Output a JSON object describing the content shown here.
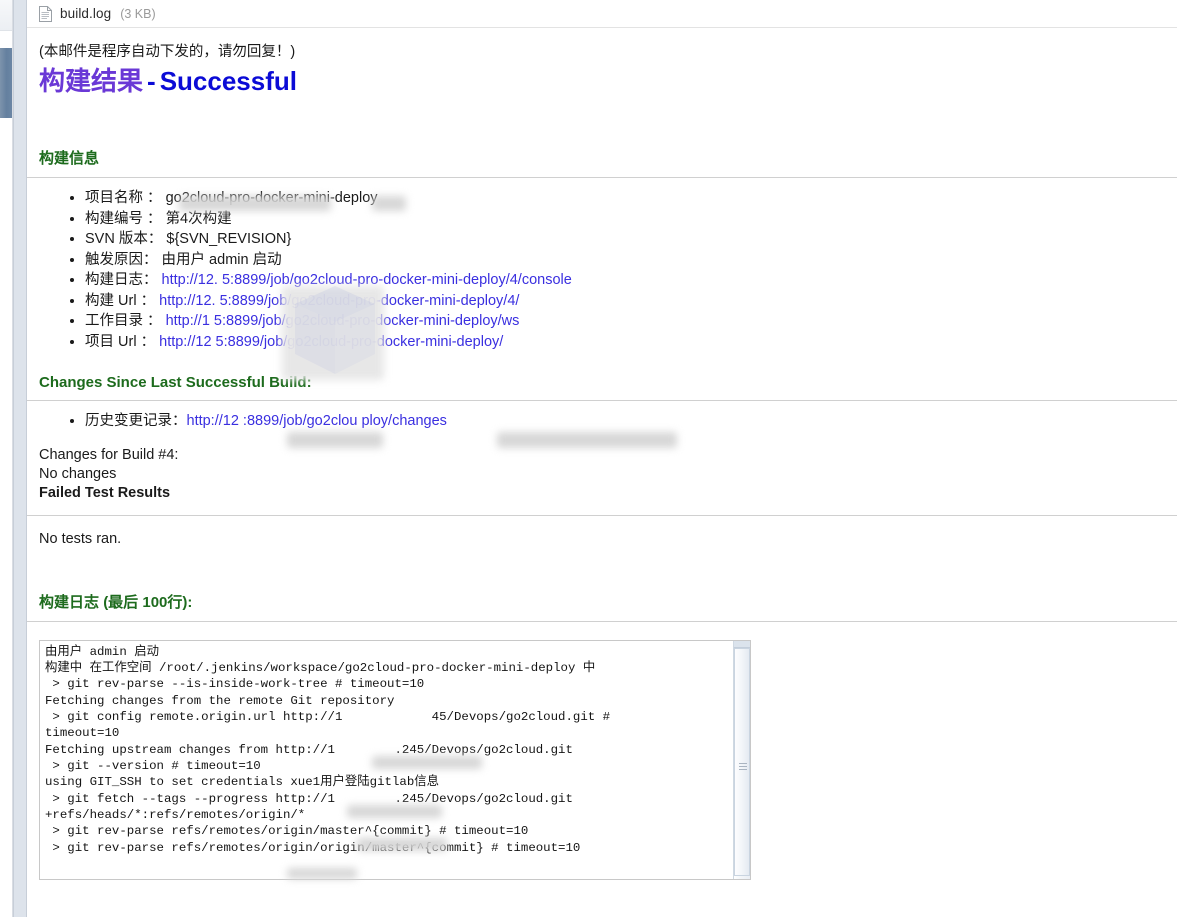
{
  "attachment": {
    "icon": "document-icon",
    "filename": "build.log",
    "size": "(3 KB)"
  },
  "mail": {
    "auto_note": "(本邮件是程序自动下发的，请勿回复！)",
    "title_cn": "构建结果",
    "title_dash": "-",
    "title_status": "Successful",
    "status_color": "#0b0bd6",
    "title_color": "#6a38d6"
  },
  "build_info": {
    "heading": "构建信息",
    "items": [
      {
        "label": "项目名称 ：",
        "value": "go2cloud-pro-docker-mini-deploy",
        "is_link": false
      },
      {
        "label": "构建编号 ：",
        "value": "第4次构建",
        "is_link": false
      },
      {
        "label": "SVN 版本：",
        "value": "${SVN_REVISION}",
        "is_link": false
      },
      {
        "label": "触发原因：",
        "value": "由用户 admin 启动",
        "is_link": false
      },
      {
        "label": "构建日志：",
        "value": "http://12.     5:8899/job/go2cloud-pro-docker-mini-deploy/4/console",
        "is_link": true
      },
      {
        "label": "构建 Url ：",
        "value": "http://12.     5:8899/job/go2cloud-pro-docker-mini-deploy/4/",
        "is_link": true
      },
      {
        "label": "工作目录 ：",
        "value": "http://1      5:8899/job/go2cloud-pro-docker-mini-deploy/ws",
        "is_link": true
      },
      {
        "label": "项目 Url ：",
        "value": "http://12     5:8899/job/go2cloud-pro-docker-mini-deploy/",
        "is_link": true
      }
    ]
  },
  "changes": {
    "heading": "Changes Since Last Successful Build:",
    "items": [
      {
        "label": "历史变更记录：",
        "value": "http://12      :8899/job/go2clou                ploy/changes",
        "is_link": true
      }
    ],
    "build_line": "Changes for Build #4:",
    "no_changes": "No changes",
    "failed_tests_heading": "Failed Test Results",
    "no_tests": "No tests ran."
  },
  "console": {
    "heading_cn": "构建日志",
    "heading_suffix": "(最后 100行):",
    "lines": [
      "由用户 admin 启动",
      "构建中 在工作空间 /root/.jenkins/workspace/go2cloud-pro-docker-mini-deploy 中",
      " > git rev-parse --is-inside-work-tree # timeout=10",
      "Fetching changes from the remote Git repository",
      " > git config remote.origin.url http://1            45/Devops/go2cloud.git #",
      "timeout=10",
      "Fetching upstream changes from http://1        .245/Devops/go2cloud.git",
      " > git --version # timeout=10",
      "using GIT_SSH to set credentials xue1用户登陆gitlab信息",
      " > git fetch --tags --progress http://1        .245/Devops/go2cloud.git",
      "+refs/heads/*:refs/remotes/origin/*",
      " > git rev-parse refs/remotes/origin/master^{commit} # timeout=10",
      " > git rev-parse refs/remotes/origin/origin/master^{commit} # timeout=10"
    ]
  }
}
